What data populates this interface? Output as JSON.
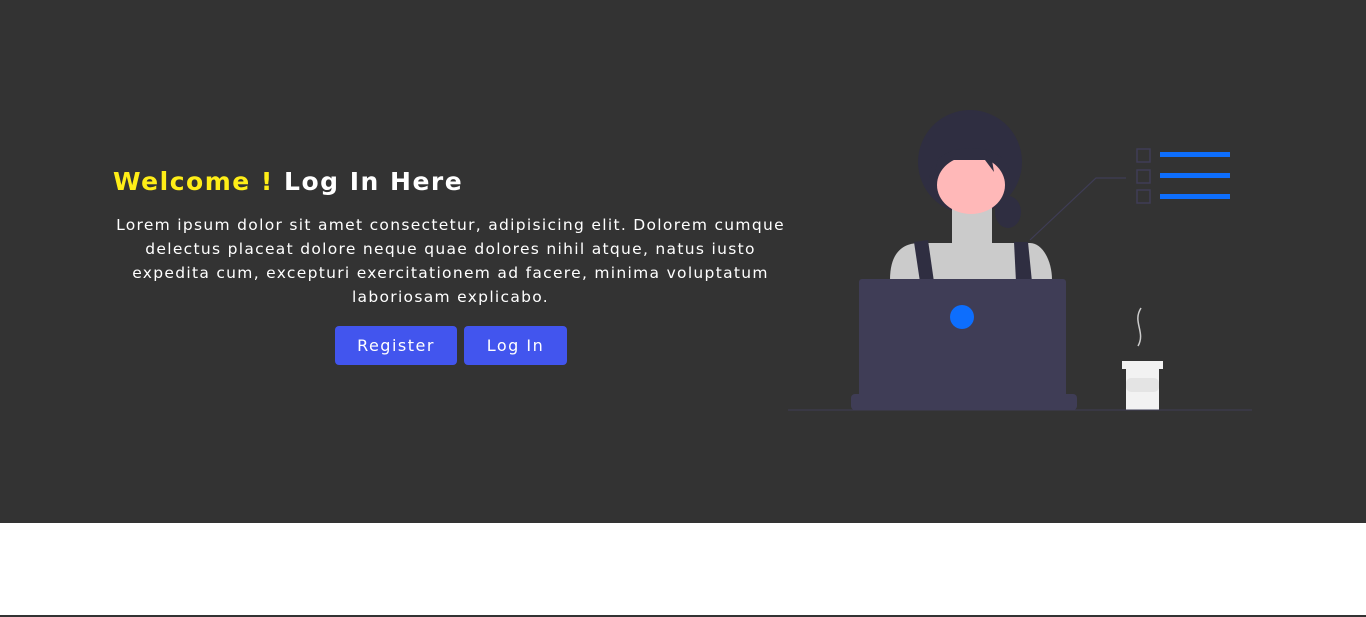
{
  "hero": {
    "title_accent": "Welcome !",
    "title_main": "Log In Here",
    "description": "Lorem ipsum dolor sit amet consectetur, adipisicing elit. Dolorem cumque delectus placeat dolore neque quae dolores nihil atque, natus iusto expedita cum, excepturi exercitationem ad facere, minima voluptatum laboriosam explicabo.",
    "register_label": "Register",
    "login_label": "Log In"
  },
  "colors": {
    "background": "#333333",
    "accent": "#ffee17",
    "button": "#4255ee",
    "illustration_blue": "#0d6efd"
  },
  "illustration": {
    "icon": "woman-at-laptop-illustration"
  }
}
